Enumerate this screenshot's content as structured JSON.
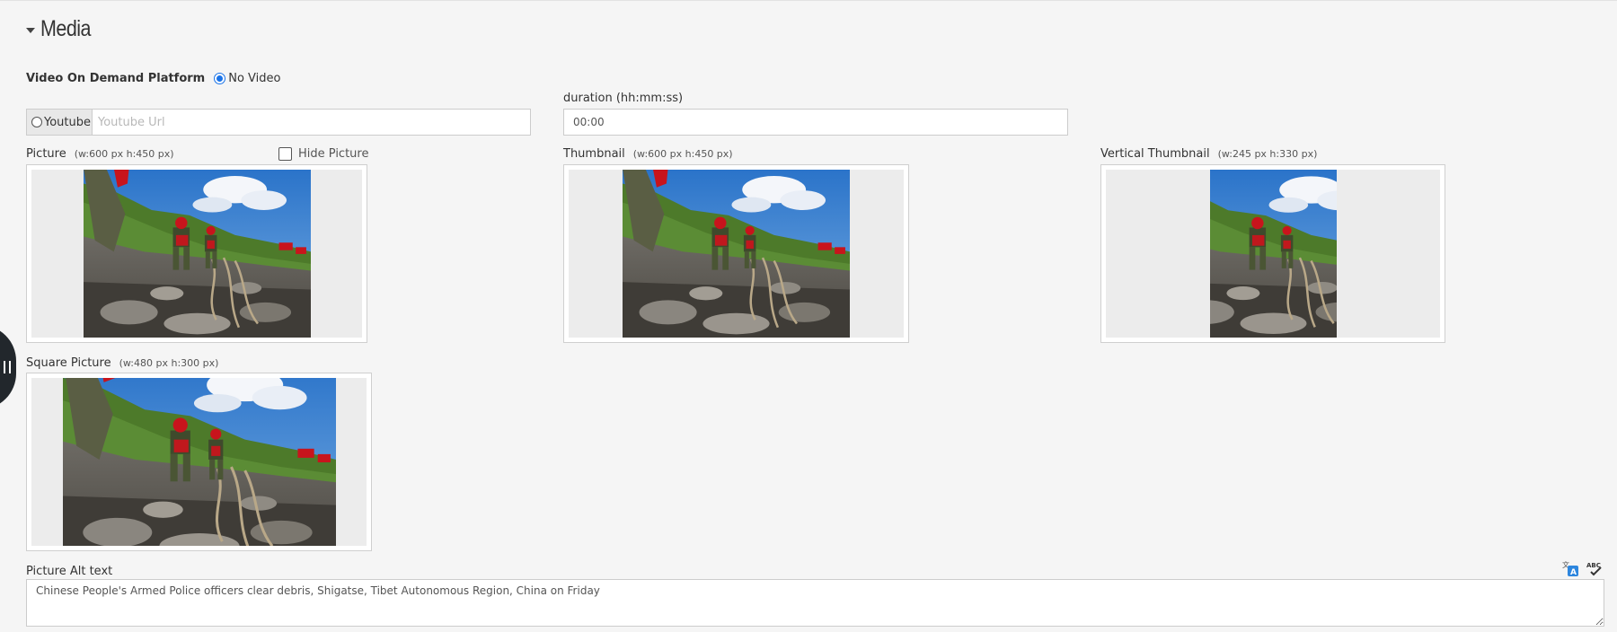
{
  "section": {
    "title": "Media"
  },
  "vod": {
    "label": "Video On Demand Platform",
    "options": [
      {
        "label": "No Video",
        "checked": true
      },
      {
        "label": "Youtube",
        "checked": false
      }
    ],
    "youtube_placeholder": "Youtube Url"
  },
  "duration": {
    "label": "duration (hh:mm:ss)",
    "value": "00:00"
  },
  "pictures": {
    "picture": {
      "label": "Picture",
      "dims": "(w:600 px   h:450 px)"
    },
    "hide_picture": {
      "label": "Hide Picture",
      "checked": false
    },
    "thumbnail": {
      "label": "Thumbnail",
      "dims": "(w:600 px   h:450 px)"
    },
    "vertical_thumbnail": {
      "label": "Vertical Thumbnail",
      "dims": "(w:245 px   h:330 px)"
    },
    "square_picture": {
      "label": "Square Picture",
      "dims": "(w:480 px   h:300 px)"
    }
  },
  "alt_text": {
    "label": "Picture Alt text",
    "value": "Chinese People's Armed Police officers clear debris, Shigatse, Tibet Autonomous Region, China on Friday"
  },
  "icons": {
    "translate": "translate-icon",
    "spellcheck": "spellcheck-icon",
    "sidebar_toggle": "sidebar-toggle-icon"
  },
  "colors": {
    "accent": "#1a73e8",
    "background": "#f5f5f5",
    "sidebar": "#22272c"
  }
}
